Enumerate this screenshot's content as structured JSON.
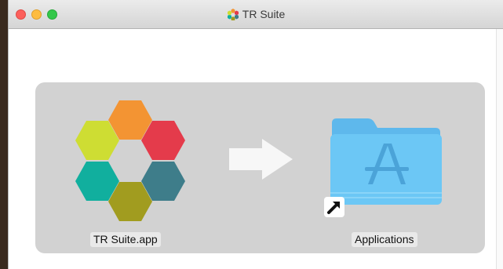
{
  "window": {
    "title": "TR Suite",
    "title_icon": "tr-suite-mini-icon"
  },
  "items": {
    "app": {
      "label": "TR Suite.app",
      "icon": "tr-suite-hexagon-icon"
    },
    "arrow": {
      "icon": "right-arrow-icon"
    },
    "applications": {
      "label": "Applications",
      "icon": "applications-folder-icon",
      "badge": "alias-arrow-icon"
    }
  },
  "colors": {
    "hex_orange": "#F39433",
    "hex_red": "#E43B4B",
    "hex_teal_dark": "#3E7D8A",
    "hex_olive": "#A19C1F",
    "hex_teal": "#11AF9E",
    "hex_lime": "#CEDD33",
    "folder_blue": "#6CC7F5",
    "background": "#D2D2D2"
  }
}
